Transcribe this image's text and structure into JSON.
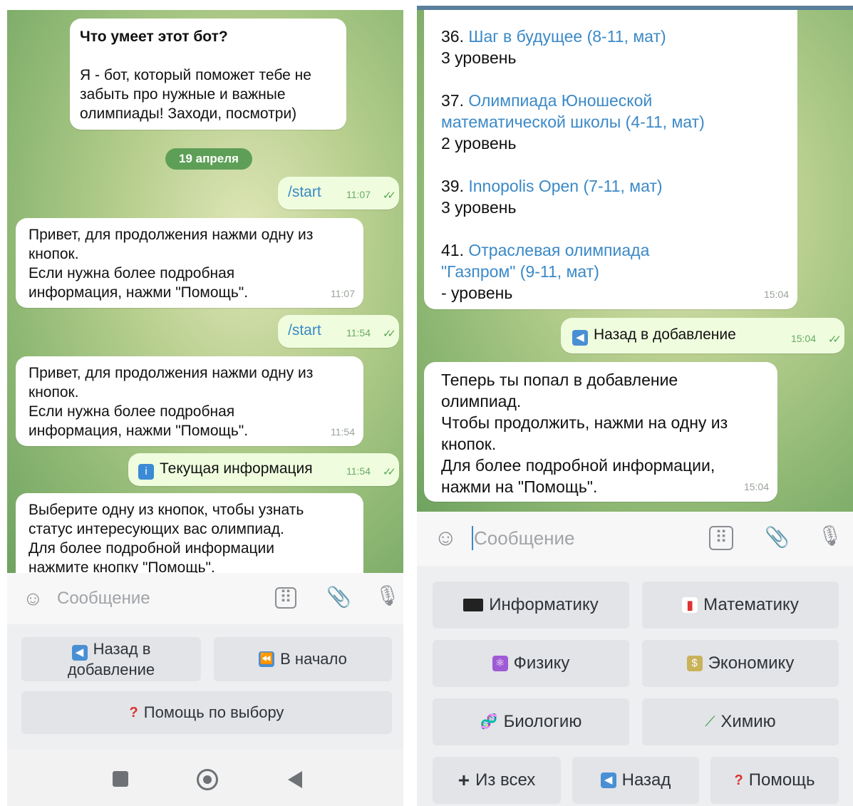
{
  "left": {
    "intro": {
      "title": "Что умеет этот бот?",
      "lines": [
        "Я - бот, который поможет тебе не",
        "забыть про нужные и важные",
        "олимпиады! Заходи, посмотри)"
      ]
    },
    "date_pill": "19 апреля",
    "msg1": {
      "text": "/start",
      "time": "11:07"
    },
    "msg2": {
      "lines": [
        "Привет, для продолжения нажми одну из",
        "кнопок.",
        "Если нужна более подробная",
        "информация, нажми \"Помощь\"."
      ],
      "time": "11:07"
    },
    "msg3": {
      "text": "/start",
      "time": "11:54"
    },
    "msg4": {
      "lines": [
        "Привет, для продолжения нажми одну из",
        "кнопок.",
        "Если нужна более подробная",
        "информация, нажми \"Помощь\"."
      ],
      "time": "11:54"
    },
    "msg5": {
      "text": "Текущая информация",
      "time": "11:54"
    },
    "msg6": {
      "lines": [
        "Выберите одну из кнопок, чтобы узнать",
        "статус интересующих вас олимпиад.",
        "Для более подробной информации",
        "нажмите кнопку \"Помощь\"."
      ]
    },
    "input_placeholder": "Сообщение",
    "keyboard": {
      "back_line1": "Назад в",
      "back_line2": "добавление",
      "start": "В начало",
      "help": "Помощь по выбору"
    }
  },
  "right": {
    "olympiads": [
      {
        "num": "36.",
        "name_lines": [
          "Шаг в будущее (8-11, мат)"
        ],
        "level": "3 уровень"
      },
      {
        "num": "37.",
        "name_lines": [
          "Олимпиада Юношеской",
          "математической школы (4-11, мат)"
        ],
        "level": "2 уровень"
      },
      {
        "num": "39.",
        "name_lines": [
          "Innopolis Open (7-11, мат)"
        ],
        "level": "3 уровень"
      },
      {
        "num": "41.",
        "name_lines": [
          "Отраслевая олимпиада",
          "\"Газпром\" (9-11, мат)"
        ],
        "level": "- уровень"
      }
    ],
    "list_time": "15:04",
    "msg_back": {
      "text": "Назад в добавление",
      "time": "15:04"
    },
    "msg_info": {
      "lines": [
        "Теперь ты попал в добавление",
        "олимпиад.",
        "Чтобы продолжить, нажми на одну из",
        "кнопок.",
        "Для более подробной информации,",
        "нажми на \"Помощь\"."
      ],
      "time": "15:04"
    },
    "input_placeholder": "Сообщение",
    "keyboard": {
      "informatics": "Информатику",
      "math": "Математику",
      "physics": "Физику",
      "economics": "Экономику",
      "biology": "Биологию",
      "chemistry": "Химию",
      "from_all": "Из всех",
      "back": "Назад",
      "help": "Помощь"
    }
  },
  "colors": {
    "chat_green": "#8fb874",
    "outgoing_bubble": "#effdde",
    "link_blue": "#3b89c7",
    "date_pill": "#5e9f57",
    "keyboard_button": "#e2e4e7"
  }
}
